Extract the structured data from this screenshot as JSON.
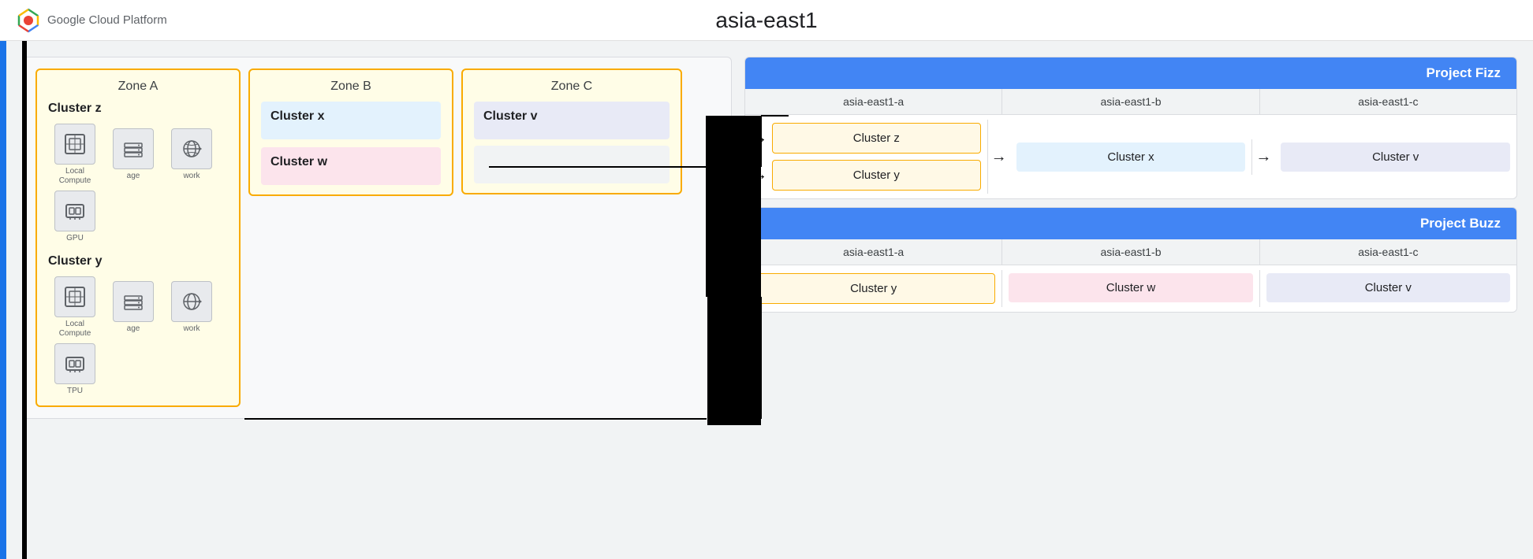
{
  "header": {
    "logo_text": "Google Cloud Platform",
    "title": "asia-east1"
  },
  "left_accent_color": "#1a73e8",
  "zones_section": {
    "zone_a": {
      "label": "Zone A",
      "cluster_z": {
        "name": "Cluster z",
        "icons": [
          {
            "label": "Local\nCompute",
            "symbol": "💻"
          },
          {
            "label": "age",
            "symbol": "🗄"
          },
          {
            "label": "work",
            "symbol": "🔌"
          },
          {
            "label": "GPU",
            "symbol": "⬛"
          }
        ]
      },
      "cluster_y": {
        "name": "Cluster y",
        "icons": [
          {
            "label": "Local\nCompute",
            "symbol": "💻"
          },
          {
            "label": "age",
            "symbol": "🗄"
          },
          {
            "label": "work",
            "symbol": "🔌"
          },
          {
            "label": "TPU",
            "symbol": "⬛"
          }
        ]
      }
    },
    "zone_b": {
      "label": "Zone B",
      "cluster_x": {
        "name": "Cluster x"
      },
      "cluster_w": {
        "name": "Cluster w"
      }
    },
    "zone_c": {
      "label": "Zone C",
      "cluster_v": {
        "name": "Cluster v"
      }
    }
  },
  "project_fizz": {
    "title": "Project Fizz",
    "zones": [
      "asia-east1-a",
      "asia-east1-b",
      "asia-east1-c"
    ],
    "clusters_col_a": [
      "Cluster z",
      "Cluster y"
    ],
    "clusters_col_b": [
      "Cluster x"
    ],
    "clusters_col_c": [
      "Cluster v"
    ]
  },
  "project_buzz": {
    "title": "Project Buzz",
    "zones": [
      "asia-east1-a",
      "asia-east1-b",
      "asia-east1-c"
    ],
    "clusters": [
      "Cluster y",
      "Cluster w",
      "Cluster v"
    ]
  },
  "colors": {
    "blue_header": "#4285f4",
    "yellow_border": "#f9ab00",
    "yellow_bg": "#fff9e6",
    "blue_cluster_bg": "#e3f2fd",
    "pink_cluster_bg": "#fce4ec",
    "purple_cluster_bg": "#e8eaf6",
    "gray_cluster_bg": "#f1f3f4"
  }
}
